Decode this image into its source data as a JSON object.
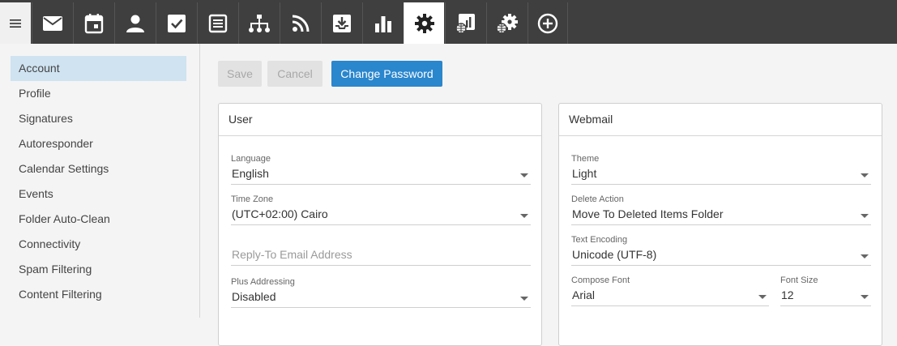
{
  "toolbar": {
    "items": [
      {
        "icon": "menu-icon"
      },
      {
        "icon": "mail-icon"
      },
      {
        "icon": "calendar-icon"
      },
      {
        "icon": "contacts-icon"
      },
      {
        "icon": "tasks-icon"
      },
      {
        "icon": "notes-icon"
      },
      {
        "icon": "sitemap-icon"
      },
      {
        "icon": "rss-icon"
      },
      {
        "icon": "inbox-download-icon"
      },
      {
        "icon": "reports-icon"
      },
      {
        "icon": "settings-gear-icon",
        "active": true
      },
      {
        "icon": "domain-reports-icon"
      },
      {
        "icon": "domain-settings-icon"
      },
      {
        "icon": "add-circle-icon"
      }
    ]
  },
  "sidebar": {
    "items": [
      {
        "label": "Account",
        "selected": true
      },
      {
        "label": "Profile"
      },
      {
        "label": "Signatures"
      },
      {
        "label": "Autoresponder"
      },
      {
        "label": "Calendar Settings"
      },
      {
        "label": "Events"
      },
      {
        "label": "Folder Auto-Clean"
      },
      {
        "label": "Connectivity"
      },
      {
        "label": "Spam Filtering"
      },
      {
        "label": "Content Filtering"
      }
    ]
  },
  "actions": {
    "save_label": "Save",
    "cancel_label": "Cancel",
    "change_password_label": "Change Password"
  },
  "user_card": {
    "title": "User",
    "language_label": "Language",
    "language_value": "English",
    "timezone_label": "Time Zone",
    "timezone_value": "(UTC+02:00) Cairo",
    "reply_to_placeholder": "Reply-To Email Address",
    "plus_label": "Plus Addressing",
    "plus_value": "Disabled"
  },
  "webmail_card": {
    "title": "Webmail",
    "theme_label": "Theme",
    "theme_value": "Light",
    "delete_label": "Delete Action",
    "delete_value": "Move To Deleted Items Folder",
    "encoding_label": "Text Encoding",
    "encoding_value": "Unicode (UTF-8)",
    "font_label": "Compose Font",
    "font_value": "Arial",
    "size_label": "Font Size",
    "size_value": "12"
  },
  "colors": {
    "toolbar_bg": "#3f3f3f",
    "accent": "#2a86cd",
    "selected_nav": "#cfe3f1"
  }
}
